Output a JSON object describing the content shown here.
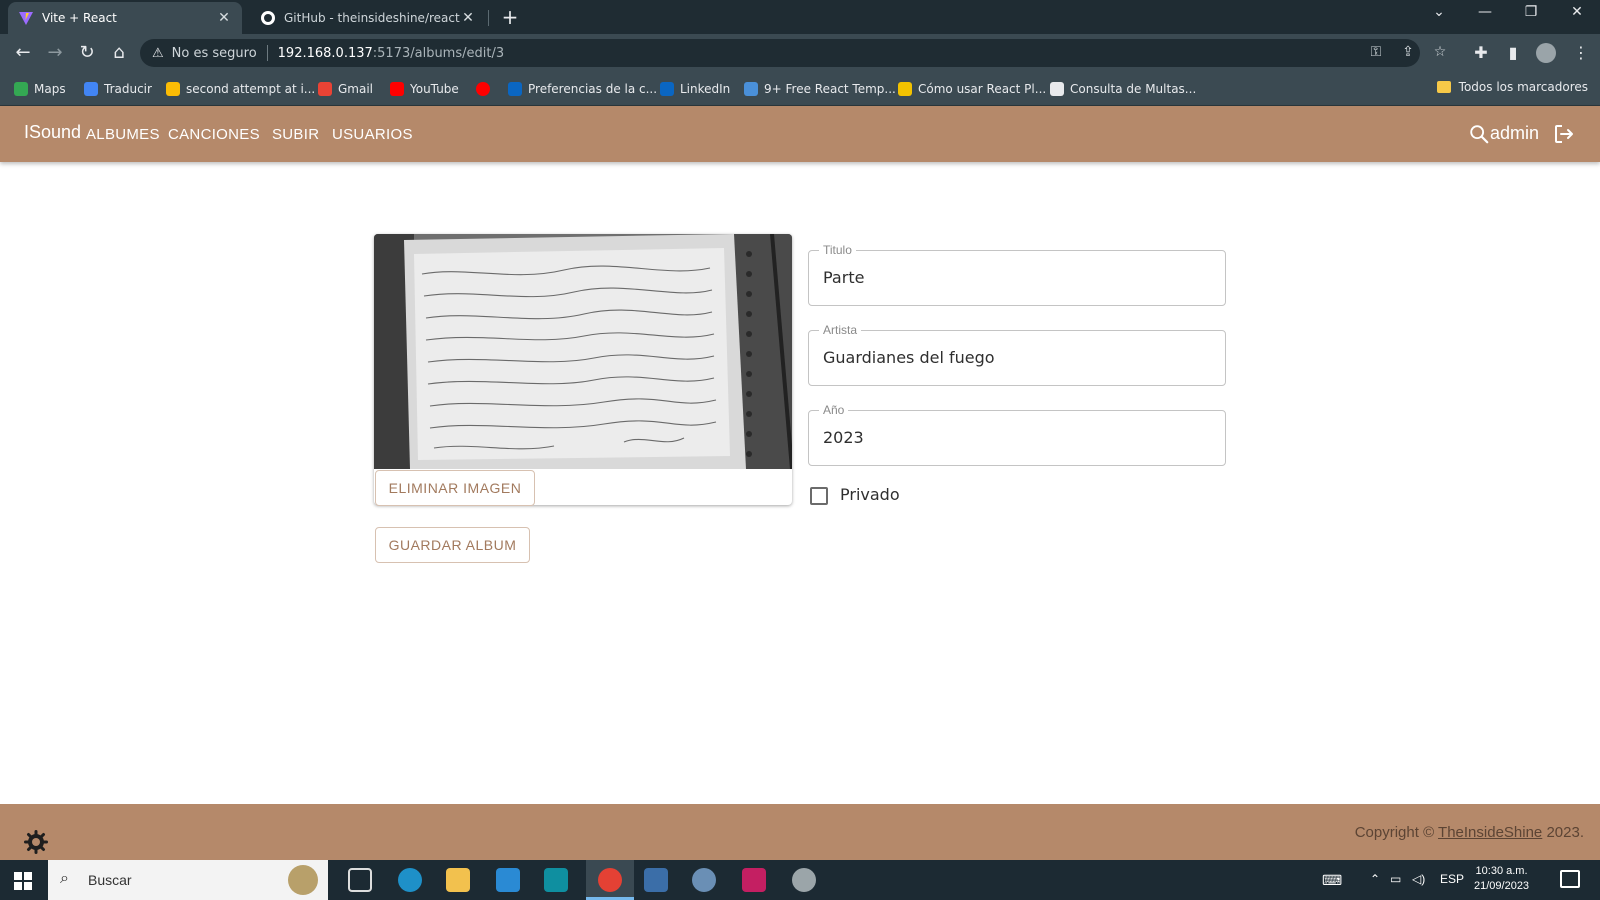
{
  "browser": {
    "tabs": [
      {
        "title": "Vite + React",
        "active": true
      },
      {
        "title": "GitHub - theinsideshine/react-insi",
        "active": false
      }
    ],
    "address": {
      "security": "No es seguro",
      "host": "192.168.0.137",
      "path": ":5173/albums/edit/3"
    },
    "bookmarks": [
      {
        "label": "Maps",
        "color": "#34a853"
      },
      {
        "label": "Traducir",
        "color": "#4285f4"
      },
      {
        "label": "second attempt at i...",
        "color": "#fbbc05"
      },
      {
        "label": "Gmail",
        "color": "#ea4335"
      },
      {
        "label": "YouTube",
        "color": "#ff0000"
      },
      {
        "label": "",
        "color": "#ff0000"
      },
      {
        "label": "Preferencias de la c...",
        "color": "#0a66c2"
      },
      {
        "label": "LinkedIn",
        "color": "#0a66c2"
      },
      {
        "label": "9+ Free React Temp...",
        "color": "#4a90d9"
      },
      {
        "label": "Cómo usar React Pl...",
        "color": "#111111"
      },
      {
        "label": "Consulta de Multas...",
        "color": "#e8eaed"
      }
    ],
    "all_bookmarks": "Todos los marcadores"
  },
  "app": {
    "brand": "ISound",
    "nav": [
      "ALBUMES",
      "CANCIONES",
      "SUBIR",
      "USUARIOS"
    ],
    "user": "admin",
    "accent": "#b5896a"
  },
  "form": {
    "remove_image_label": "ELIMINAR IMAGEN",
    "save_label": "GUARDAR ALBUM",
    "title": {
      "label": "Titulo",
      "value": "Parte"
    },
    "artist": {
      "label": "Artista",
      "value": "Guardianes del fuego"
    },
    "year": {
      "label": "Año",
      "value": "2023"
    },
    "private": {
      "label": "Privado",
      "checked": false
    }
  },
  "footer": {
    "copyright_prefix": "Copyright © ",
    "copyright_link": "TheInsideShine",
    "copyright_suffix": " 2023."
  },
  "taskbar": {
    "search_placeholder": "Buscar",
    "language": "ESP",
    "time": "10:30 a.m.",
    "date": "21/09/2023"
  }
}
